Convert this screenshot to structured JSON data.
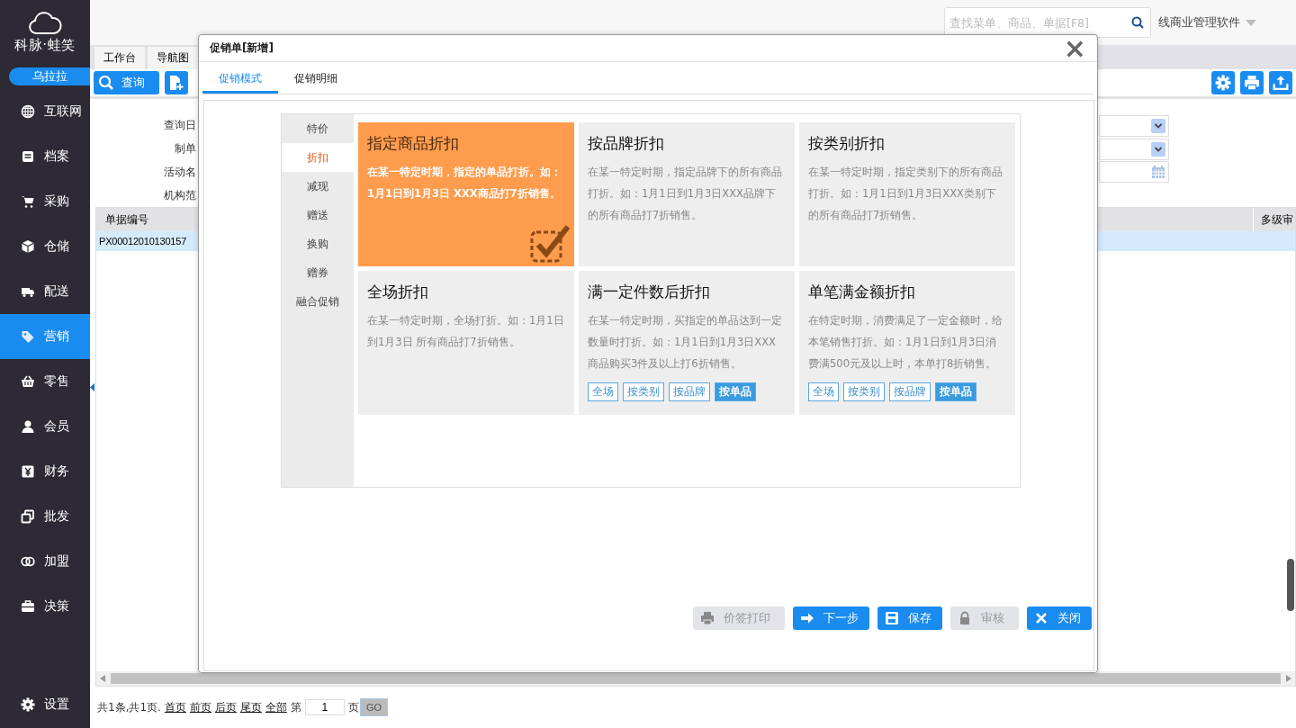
{
  "brand": {
    "name": "科脉·蛙笑",
    "user": "乌拉拉"
  },
  "sidebar": {
    "items": [
      {
        "label": "互联网",
        "selected": false
      },
      {
        "label": "档案",
        "selected": false
      },
      {
        "label": "采购",
        "selected": false
      },
      {
        "label": "仓储",
        "selected": false
      },
      {
        "label": "配送",
        "selected": false
      },
      {
        "label": "营销",
        "selected": true
      },
      {
        "label": "零售",
        "selected": false
      },
      {
        "label": "会员",
        "selected": false
      },
      {
        "label": "财务",
        "selected": false
      },
      {
        "label": "批发",
        "selected": false
      },
      {
        "label": "加盟",
        "selected": false
      },
      {
        "label": "决策",
        "selected": false
      }
    ],
    "footer": "设置"
  },
  "header": {
    "search": {
      "placeholder": "查找菜单、商品、单据[F8]"
    },
    "product": "线商业管理软件"
  },
  "page_tabs": [
    {
      "label": "工作台"
    },
    {
      "label": "导航图"
    }
  ],
  "toolbar": {
    "query_button": "查询"
  },
  "filters": [
    {
      "label": "查询日",
      "kind": "select"
    },
    {
      "label": "制单",
      "kind": "select"
    },
    {
      "label": "活动名",
      "kind": "date"
    },
    {
      "label": "机构范",
      "kind": "none"
    }
  ],
  "table": {
    "columns": [
      "单据编号",
      "多级审"
    ],
    "rows": [
      {
        "cells": [
          "PX00012010130157"
        ],
        "selected": true
      }
    ]
  },
  "pagination": {
    "summary": "共1条,共1页.",
    "links": [
      "首页",
      "前页",
      "后页",
      "尾页",
      "全部"
    ],
    "page_prefix": "第",
    "page": "1",
    "page_suffix": "页",
    "go": "GO"
  },
  "dialog": {
    "title": "促销单[新增]",
    "close": "×",
    "tabs": [
      {
        "label": "促销模式",
        "selected": true
      },
      {
        "label": "促销明细",
        "selected": false
      }
    ],
    "categories": [
      {
        "label": "特价",
        "selected": false
      },
      {
        "label": "折扣",
        "selected": true
      },
      {
        "label": "减现",
        "selected": false
      },
      {
        "label": "赠送",
        "selected": false
      },
      {
        "label": "换购",
        "selected": false
      },
      {
        "label": "赠券",
        "selected": false
      },
      {
        "label": "融合促销",
        "selected": false
      }
    ],
    "cards": [
      {
        "title": "指定商品折扣",
        "description": "在某一特定时期，指定的单品打折。如：1月1日到1月3日 XXX商品打7折销售。",
        "selected": true
      },
      {
        "title": "按品牌折扣",
        "description": "在某一特定时期，指定品牌下的所有商品打折。如：1月1日到1月3日XXX品牌下的所有商品打7折销售。",
        "selected": false
      },
      {
        "title": "按类别折扣",
        "description": "在某一特定时期，指定类别下的所有商品打折。如：1月1日到1月3日XXX类别下的所有商品打7折销售。",
        "selected": false
      },
      {
        "title": "全场折扣",
        "description": "在某一特定时期，全场打折。如：1月1日到1月3日 所有商品打7折销售。",
        "selected": false
      },
      {
        "title": "满一定件数后折扣",
        "description": "在某一特定时期，买指定的单品达到一定数量时打折。如：1月1日到1月3日XXX商品购买3件及以上打6折销售。",
        "selected": false,
        "tags": [
          {
            "label": "全场",
            "selected": false
          },
          {
            "label": "按类别",
            "selected": false
          },
          {
            "label": "按品牌",
            "selected": false
          },
          {
            "label": "按单品",
            "selected": true
          }
        ]
      },
      {
        "title": "单笔满金额折扣",
        "description": "在特定时期，消费满足了一定金额时，给本笔销售打折。如：1月1日到1月3日消费满500元及以上时，本单打8折销售。",
        "selected": false,
        "tags": [
          {
            "label": "全场",
            "selected": false
          },
          {
            "label": "按类别",
            "selected": false
          },
          {
            "label": "按品牌",
            "selected": false
          },
          {
            "label": "按单品",
            "selected": true
          }
        ]
      }
    ],
    "buttons": [
      {
        "label": "价签打印",
        "disabled": true
      },
      {
        "label": "下一步",
        "disabled": false
      },
      {
        "label": "保存",
        "disabled": false
      },
      {
        "label": "审核",
        "disabled": true
      },
      {
        "label": "关闭",
        "disabled": false
      }
    ]
  }
}
